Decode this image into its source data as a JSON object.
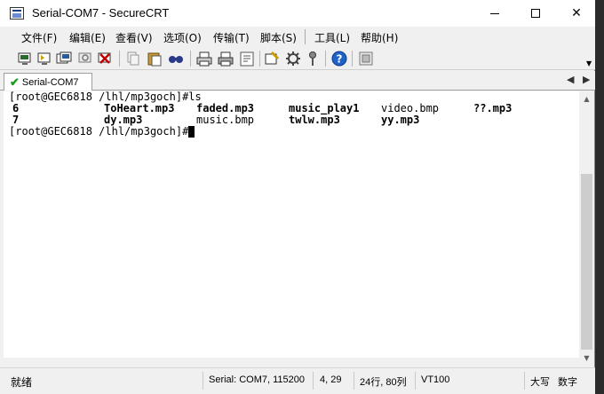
{
  "window": {
    "title": "Serial-COM7 - SecureCRT"
  },
  "menu": {
    "items": [
      "文件(F)",
      "编辑(E)",
      "查看(V)",
      "选项(O)",
      "传输(T)",
      "脚本(S)",
      "工具(L)",
      "帮助(H)"
    ]
  },
  "toolbar": {
    "buttons": [
      "connect-icon",
      "quick-connect-icon",
      "connect-in-tab-icon",
      "reconnect-icon",
      "disconnect-icon",
      "copy-icon",
      "paste-icon",
      "find-icon",
      "print-icon",
      "print-setup-icon",
      "session-options-icon",
      "global-options-icon",
      "keymap-icon",
      "help-icon",
      "sftp-icon"
    ]
  },
  "tabs": {
    "active": "Serial-COM7"
  },
  "terminal": {
    "line1": "[root@GEC6818 /lhl/mp3goch]#ls",
    "row1": [
      "6",
      "ToHeart.mp3",
      "faded.mp3",
      "music_play1",
      "video.bmp",
      "??.mp3"
    ],
    "row2": [
      "7",
      "dy.mp3",
      "music.bmp",
      "twlw.mp3",
      "yy.mp3"
    ],
    "prompt": "[root@GEC6818 /lhl/mp3goch]#"
  },
  "status": {
    "ready": "就绪",
    "connection": "Serial: COM7, 115200",
    "cursor_pos": "4,  29",
    "size": "24行, 80列",
    "emulation": "VT100",
    "caps": "大写",
    "num": "数字"
  }
}
